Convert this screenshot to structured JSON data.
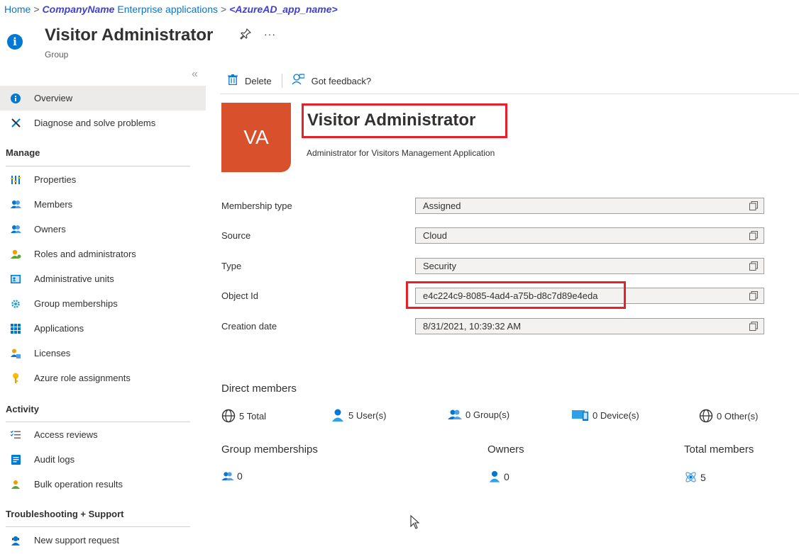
{
  "breadcrumb": {
    "home": "Home",
    "company": "CompanyName",
    "enterprise_apps": "Enterprise applications",
    "app": "<AzureAD_app_name>",
    "sep": ">"
  },
  "header": {
    "title": "Visitor Administrator",
    "subtitle": "Group",
    "info_glyph": "i",
    "pin_glyph": "✎",
    "more_glyph": "···"
  },
  "sidebar": {
    "collapse_glyph": "«",
    "items": [
      {
        "label": "Overview",
        "icon": "info-icon"
      },
      {
        "label": "Diagnose and solve problems",
        "icon": "wrench-icon"
      }
    ],
    "sections": [
      {
        "title": "Manage",
        "items": [
          {
            "label": "Properties",
            "icon": "properties-icon"
          },
          {
            "label": "Members",
            "icon": "members-icon"
          },
          {
            "label": "Owners",
            "icon": "owners-icon"
          },
          {
            "label": "Roles and administrators",
            "icon": "roles-icon"
          },
          {
            "label": "Administrative units",
            "icon": "admin-units-icon"
          },
          {
            "label": "Group memberships",
            "icon": "gear-icon"
          },
          {
            "label": "Applications",
            "icon": "grid-icon"
          },
          {
            "label": "Licenses",
            "icon": "license-icon"
          },
          {
            "label": "Azure role assignments",
            "icon": "key-icon"
          }
        ]
      },
      {
        "title": "Activity",
        "items": [
          {
            "label": "Access reviews",
            "icon": "list-check-icon"
          },
          {
            "label": "Audit logs",
            "icon": "audit-log-icon"
          },
          {
            "label": "Bulk operation results",
            "icon": "bulk-icon"
          }
        ]
      },
      {
        "title": "Troubleshooting + Support",
        "items": [
          {
            "label": "New support request",
            "icon": "support-icon"
          }
        ]
      }
    ]
  },
  "toolbar": {
    "delete_label": "Delete",
    "feedback_label": "Got feedback?"
  },
  "group": {
    "initials": "VA",
    "name": "Visitor Administrator",
    "description": "Administrator for Visitors Management Application",
    "avatar_color": "#d9512c"
  },
  "properties": [
    {
      "label": "Membership type",
      "value": "Assigned"
    },
    {
      "label": "Source",
      "value": "Cloud"
    },
    {
      "label": "Type",
      "value": "Security"
    },
    {
      "label": "Object Id",
      "value": "e4c224c9-8085-4ad4-a75b-d8c7d89e4eda"
    },
    {
      "label": "Creation date",
      "value": "8/31/2021, 10:39:32 AM"
    }
  ],
  "direct_members": {
    "title": "Direct members",
    "total": "5 Total",
    "users": "5 User(s)",
    "groups": "0 Group(s)",
    "devices": "0 Device(s)",
    "others": "0 Other(s)"
  },
  "stats": {
    "group_memberships_label": "Group memberships",
    "group_memberships_value": "0",
    "owners_label": "Owners",
    "owners_value": "0",
    "total_members_label": "Total members",
    "total_members_value": "5"
  },
  "colors": {
    "accent": "#0078d4",
    "highlight_box": "#e8202a"
  }
}
